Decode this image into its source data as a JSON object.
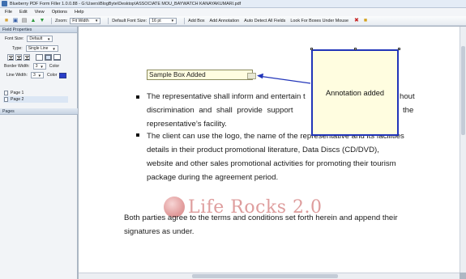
{
  "window": {
    "title": "Blueberry PDF Form Filler 1.0.0.88 - G:\\Users\\BlogByte\\Desktop\\ASSOCIATE MOU_BAYWATCH KANAYAKUMARI.pdf"
  },
  "menu": [
    "File",
    "Edit",
    "View",
    "Options",
    "Help"
  ],
  "toolbar": {
    "zoom_label": "Zoom:",
    "zoom_value": "Fit Width",
    "font_size_label": "Default Font Size:",
    "font_size_value": "16 pt",
    "add_box": "Add Box",
    "add_annotation": "Add Annotation",
    "auto_detect": "Auto Detect All Fields",
    "look_for_boxes": "Look For Boxes Under Mouse"
  },
  "field_properties": {
    "header": "Field Properties",
    "font_size_label": "Font Size:",
    "font_size_value": "Default",
    "type_label": "Type:",
    "type_value": "Single Line",
    "border_width_label": "Border Width:",
    "border_width_value": "3",
    "color_label": "Color",
    "line_width_label": "Line Width:",
    "line_width_value": "3",
    "color2_label": "Color",
    "accent_color": "#2a3fc9"
  },
  "pages": {
    "header": "Pages",
    "items": [
      "Page 1",
      "Page 2"
    ],
    "selected": "Page 2"
  },
  "document": {
    "sample_box": "Sample Box Added",
    "annotation": "Annotation added",
    "bullet1_line1_a": "The representative shall inform and entertain t",
    "bullet1_line1_b": "hout",
    "bullet1_line2_a": "discrimination   and   shall   provide   support",
    "bullet1_line2_b": "the",
    "bullet1_line3": "representative’s facility.",
    "bullet2_line1": "The client can use the logo, the name of the representative and its facilities",
    "bullet2_line2": "details  in  their  product  promotional  literature,  Data  Discs  (CD/DVD),",
    "bullet2_line3": "website  and  other  sales  promotional  activities  for  promoting  their  tourism",
    "bullet2_line4": "package during the agreement period.",
    "para_line1": "Both parties agree to the terms and conditions set forth herein and append their",
    "para_line2": "signatures as under.",
    "watermark": "Life Rocks 2.0"
  }
}
